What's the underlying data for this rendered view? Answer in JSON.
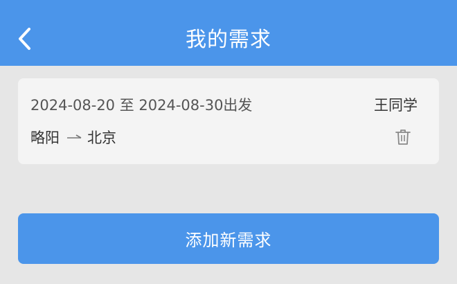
{
  "header": {
    "title": "我的需求",
    "back_icon": "chevron-left-icon"
  },
  "demand": {
    "date_range": "2024-08-20 至 2024-08-30出发",
    "person": "王同学",
    "origin": "略阳",
    "destination": "北京",
    "arrow_icon": "arrow-right-icon",
    "delete_icon": "trash-icon"
  },
  "actions": {
    "add_label": "添加新需求"
  },
  "colors": {
    "primary": "#4b95ea",
    "background": "#e6e6e6",
    "card": "#f4f4f4"
  }
}
